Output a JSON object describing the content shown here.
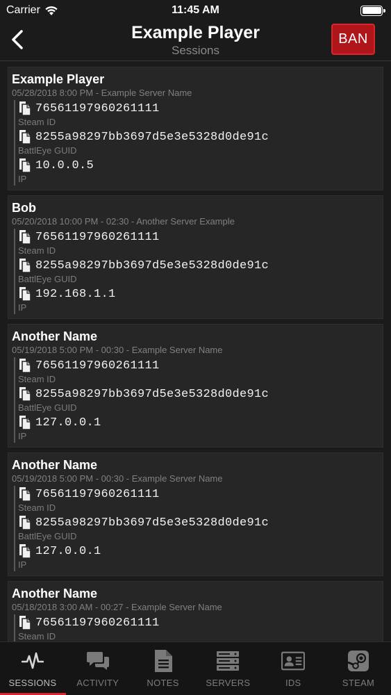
{
  "status_bar": {
    "carrier": "Carrier",
    "time": "11:45 AM"
  },
  "nav": {
    "title": "Example Player",
    "subtitle": "Sessions",
    "ban_label": "BAN"
  },
  "sessions": [
    {
      "name": "Example Player",
      "meta": "05/28/2018 8:00 PM - Example Server Name",
      "ids": [
        {
          "value": "76561197960261111",
          "label": "Steam ID"
        },
        {
          "value": "8255a98297bb3697d5e3e5328d0de91c",
          "label": "BattlEye GUID"
        },
        {
          "value": "10.0.0.5",
          "label": "IP"
        }
      ]
    },
    {
      "name": "Bob",
      "meta": "05/20/2018 10:00 PM - 02:30 - Another Server Example",
      "ids": [
        {
          "value": "76561197960261111",
          "label": "Steam ID"
        },
        {
          "value": "8255a98297bb3697d5e3e5328d0de91c",
          "label": "BattlEye GUID"
        },
        {
          "value": "192.168.1.1",
          "label": "IP"
        }
      ]
    },
    {
      "name": "Another Name",
      "meta": "05/19/2018 5:00 PM - 00:30 - Example Server Name",
      "ids": [
        {
          "value": "76561197960261111",
          "label": "Steam ID"
        },
        {
          "value": "8255a98297bb3697d5e3e5328d0de91c",
          "label": "BattlEye GUID"
        },
        {
          "value": "127.0.0.1",
          "label": "IP"
        }
      ]
    },
    {
      "name": "Another Name",
      "meta": "05/19/2018 5:00 PM - 00:30 - Example Server Name",
      "ids": [
        {
          "value": "76561197960261111",
          "label": "Steam ID"
        },
        {
          "value": "8255a98297bb3697d5e3e5328d0de91c",
          "label": "BattlEye GUID"
        },
        {
          "value": "127.0.0.1",
          "label": "IP"
        }
      ]
    },
    {
      "name": "Another Name",
      "meta": "05/18/2018 3:00 AM - 00:27 - Example Server Name",
      "ids": [
        {
          "value": "76561197960261111",
          "label": "Steam ID"
        }
      ]
    }
  ],
  "tabs": [
    {
      "label": "SESSIONS",
      "icon": "activity-pulse-icon",
      "active": true
    },
    {
      "label": "ACTIVITY",
      "icon": "chat-bubbles-icon",
      "active": false
    },
    {
      "label": "NOTES",
      "icon": "document-icon",
      "active": false
    },
    {
      "label": "SERVERS",
      "icon": "server-rack-icon",
      "active": false
    },
    {
      "label": "IDS",
      "icon": "id-card-icon",
      "active": false
    },
    {
      "label": "STEAM",
      "icon": "steam-icon",
      "active": false
    }
  ],
  "colors": {
    "accent": "#d9262c",
    "ban_button": "#b0151a",
    "background": "#1b1b1b",
    "card": "#262626"
  }
}
